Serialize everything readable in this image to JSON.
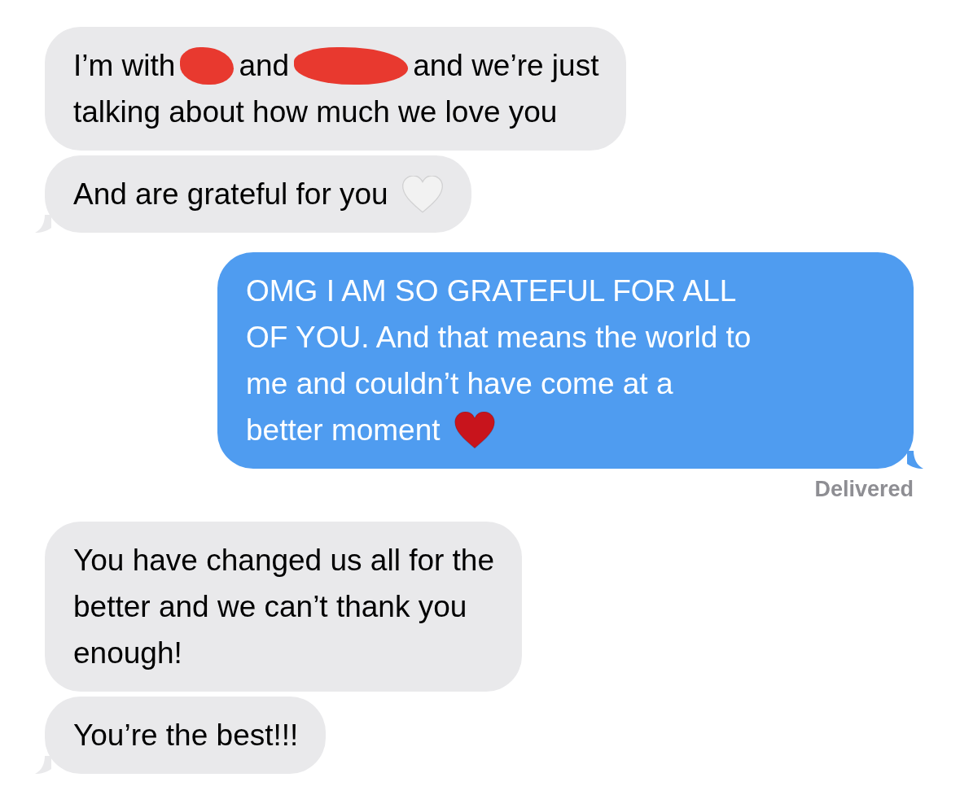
{
  "messages": [
    {
      "kind": "incoming",
      "tail": false,
      "lines": [
        [
          {
            "kind": "text",
            "text": "I’m with"
          },
          {
            "kind": "redaction"
          },
          {
            "kind": "text",
            "text": "and"
          },
          {
            "kind": "redaction"
          },
          {
            "kind": "text",
            "text": "and we’re just"
          }
        ],
        [
          {
            "kind": "text",
            "text": "talking about how much we love you"
          }
        ]
      ]
    },
    {
      "kind": "incoming",
      "tail": true,
      "lines": [
        [
          {
            "kind": "text",
            "text": "And are grateful for you"
          },
          {
            "kind": "heart",
            "color": "#f2f2f2"
          }
        ]
      ]
    },
    {
      "kind": "outgoing",
      "tail": true,
      "lines": [
        [
          {
            "kind": "text",
            "text": "OMG I AM SO GRATEFUL FOR ALL"
          }
        ],
        [
          {
            "kind": "text",
            "text": "OF YOU. And that means the world to"
          }
        ],
        [
          {
            "kind": "text",
            "text": "me and couldn’t have come at a"
          }
        ],
        [
          {
            "kind": "text",
            "text": "better moment"
          },
          {
            "kind": "heart",
            "color": "#c8141c"
          }
        ]
      ]
    },
    {
      "kind": "status",
      "text": "Delivered"
    },
    {
      "kind": "incoming",
      "tail": false,
      "lines": [
        [
          {
            "kind": "text",
            "text": "You have changed us all for the"
          }
        ],
        [
          {
            "kind": "text",
            "text": "better and we can’t thank you"
          }
        ],
        [
          {
            "kind": "text",
            "text": "enough!"
          }
        ]
      ]
    },
    {
      "kind": "incoming",
      "tail": true,
      "lines": [
        [
          {
            "kind": "text",
            "text": "You’re the best!!!"
          }
        ]
      ]
    }
  ]
}
